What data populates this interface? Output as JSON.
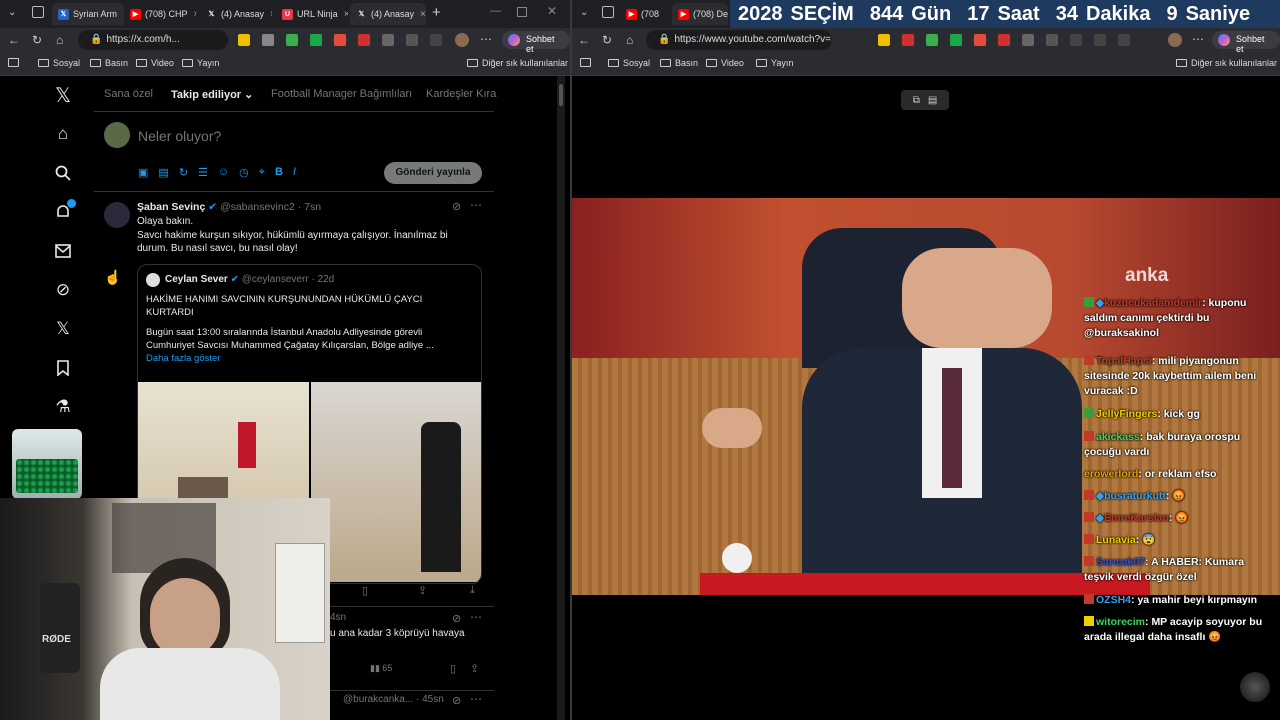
{
  "left_tabs": [
    {
      "label": "Syrian Arm",
      "icon": "x-icon",
      "color": "#e8e8e8"
    },
    {
      "label": "(708) CHP",
      "icon": "youtube-icon",
      "color": "#ff0000"
    },
    {
      "label": "(4) Anasay",
      "icon": "x-icon",
      "color": "#e8e8e8"
    },
    {
      "label": "URL Ninja",
      "icon": "urlninja-icon",
      "color": "#e63946"
    },
    {
      "label": "(4) Anasay",
      "icon": "x-icon",
      "color": "#e8e8e8"
    }
  ],
  "right_tabs": [
    {
      "label": "(708",
      "icon": "youtube-icon",
      "color": "#ff0000"
    },
    {
      "label": "(708) De",
      "icon": "youtube-icon",
      "color": "#ff0000"
    }
  ],
  "countdown": {
    "year": "2028",
    "title": "SEÇİM",
    "days": "844",
    "days_label": "Gün",
    "hours": "17",
    "hours_label": "Saat",
    "minutes": "34",
    "minutes_label": "Dakika",
    "seconds": "9",
    "seconds_label": "Saniye"
  },
  "left_url": "https://x.com/h...",
  "right_url": "https://www.youtube.com/watch?v=...",
  "sohbet_label": "Sohbet et",
  "bookmarks": {
    "items": [
      "Sosyal",
      "Basın",
      "Video",
      "Yayın"
    ],
    "other": "Diğer sık kullanılanlar"
  },
  "x_tabs": [
    "Sana özel",
    "Takip ediliyor",
    "Football Manager Bağımlıları",
    "Kardeşler Kıra"
  ],
  "compose": {
    "placeholder": "Neler oluyor?",
    "post_button": "Gönderi yayınla"
  },
  "tweet": {
    "name": "Şaban Sevinç",
    "handle": "@sabansevinc2 · 7sn",
    "line1": "Olaya bakın.",
    "line2": "Savcı hakime kurşun sıkıyor, hükümlü ayırmaya çalışıyor. İnanılmaz bi",
    "line3": "durum. Bu nasıl savcı, bu nasıl olay!"
  },
  "quote": {
    "name": "Ceylan Sever",
    "handle": "@ceylanseverr · 22d",
    "headline1": "HAKİME HANIMI SAVCININ KURŞUNUNDAN HÜKÜMLÜ ÇAYCI",
    "headline2": "KURTARDI",
    "body1": "Bugün saat 13:00 sıralarında İstanbul Anadolu Adliyesinde görevli",
    "body2": "Cumhuriyet Savcısı Muhammed Çağatay Kılıçarslan, Bölge adliye ...",
    "more": "Daha fazla göster"
  },
  "tweet2": {
    "time": "4sn",
    "text": "u ana kadar 3 köprüyü havaya",
    "views": "65"
  },
  "tweet3": {
    "handle": "@burakcanka... · 45sn"
  },
  "watermark": "anka",
  "chat": [
    {
      "user": "kuzucukadamdemir",
      "msg": "kuponu saldım canımı çektirdi bu @buraksakinol",
      "user_color": "#c0392b",
      "badge": "#3b9c3b"
    },
    {
      "user": "TopalHapsi",
      "msg": "mili piyangonun sitesinde 20k kaybettim ailem beni vuracak :D",
      "user_color": "#c0392b",
      "badge": "#c0392b"
    },
    {
      "user": "JellyFingers",
      "msg": "kick gg",
      "user_color": "#f0d000",
      "badge": "#3b9c3b"
    },
    {
      "user": "akickass",
      "msg": "bak buraya orospu çocuğu vardı",
      "user_color": "#3cd65c",
      "badge": "#c0392b"
    },
    {
      "user": "erowerlord",
      "msg": "or reklam efso",
      "user_color": "#e0a000",
      "badge": ""
    },
    {
      "user": "busraturkutt",
      "msg": "😡",
      "user_color": "#3aa0e8",
      "badge": "#c0392b"
    },
    {
      "user": "EmreKarslan",
      "msg": "😡",
      "user_color": "#3aa0e8",
      "badge": "#c0392b"
    },
    {
      "user": "Lunavia",
      "msg": "😨",
      "user_color": "#f0d000",
      "badge": "#c0392b"
    },
    {
      "user": "Sarıcak07",
      "msg": "A HABER: Kumara teşvik verdi özgür özel",
      "user_color": "#3050d0",
      "badge": "#c0392b"
    },
    {
      "user": "OZSH4",
      "msg": "ya mahir beyi kırpmayın",
      "user_color": "#3aa0e8",
      "badge": "#c0392b"
    },
    {
      "user": "witorecim",
      "msg": "MP acayip soyuyor bu arada illegal daha insaflı 😡",
      "user_color": "#3cd65c",
      "badge": "#f0d000"
    }
  ]
}
